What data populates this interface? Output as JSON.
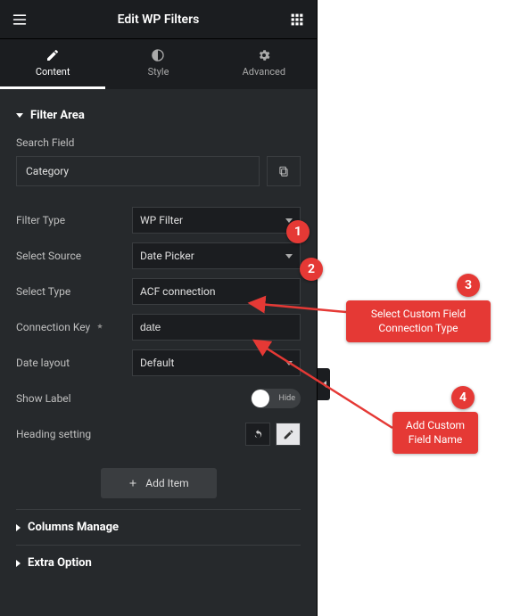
{
  "header": {
    "title": "Edit WP Filters"
  },
  "tabs": {
    "content": "Content",
    "style": "Style",
    "advanced": "Advanced"
  },
  "section": {
    "filter_area": "Filter Area",
    "columns_manage": "Columns Manage",
    "extra_option": "Extra Option"
  },
  "labels": {
    "search_field": "Search Field",
    "filter_type": "Filter Type",
    "select_source": "Select Source",
    "select_type": "Select Type",
    "connection_key": "Connection Key",
    "date_layout": "Date layout",
    "show_label": "Show Label",
    "heading_setting": "Heading setting"
  },
  "values": {
    "item_name": "Category",
    "filter_type": "WP Filter",
    "select_source": "Date Picker",
    "select_type": "ACF connection",
    "connection_key": "date",
    "date_layout": "Default",
    "switch_label": "Hide"
  },
  "buttons": {
    "add_item": "Add Item"
  },
  "callouts": {
    "c3_line1": "Select Custom Field",
    "c3_line2": "Connection Type",
    "c4_line1": "Add Custom",
    "c4_line2": "Field Name"
  }
}
